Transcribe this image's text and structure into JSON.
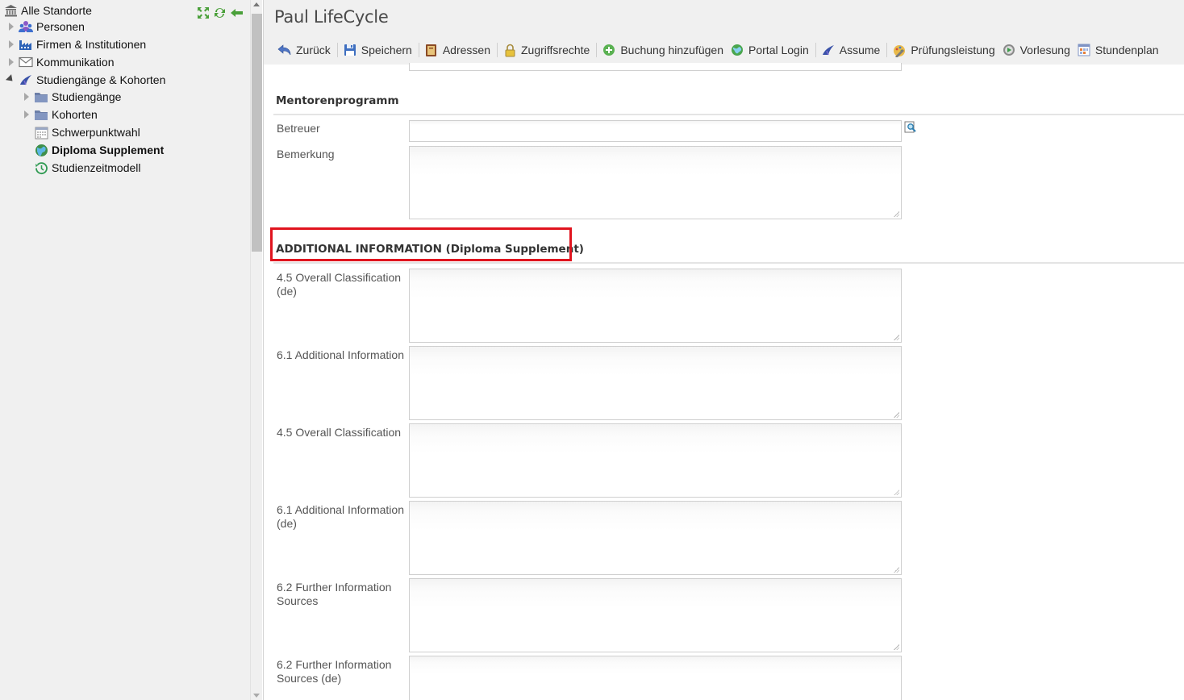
{
  "tree": {
    "root_label": "Alle Standorte",
    "items": [
      {
        "label": "Personen"
      },
      {
        "label": "Firmen & Institutionen"
      },
      {
        "label": "Kommunikation"
      },
      {
        "label": "Studiengänge & Kohorten"
      },
      {
        "label": "Studiengänge"
      },
      {
        "label": "Kohorten"
      },
      {
        "label": "Schwerpunktwahl"
      },
      {
        "label": "Diploma Supplement"
      },
      {
        "label": "Studienzeitmodell"
      }
    ],
    "selected": "Diploma Supplement"
  },
  "header": {
    "title": "Paul LifeCycle"
  },
  "toolbar": {
    "buttons": [
      {
        "label": "Zurück",
        "icon": "back-arrow-icon"
      },
      {
        "label": "Speichern",
        "icon": "save-disk-icon"
      },
      {
        "label": "Adressen",
        "icon": "address-book-icon"
      },
      {
        "label": "Zugriffsrechte",
        "icon": "lock-icon"
      },
      {
        "label": "Buchung hinzufügen",
        "icon": "add-circle-icon"
      },
      {
        "label": "Portal Login",
        "icon": "globe-icon"
      },
      {
        "label": "Assume",
        "icon": "graduation-cap-icon"
      },
      {
        "label": "Prüfungsleistung",
        "icon": "exam-pencil-icon"
      },
      {
        "label": "Vorlesung",
        "icon": "lecture-icon"
      },
      {
        "label": "Stundenplan",
        "icon": "calendar-grid-icon"
      }
    ]
  },
  "form": {
    "mentoring": {
      "title": "Mentorenprogramm",
      "betreuer_label": "Betreuer",
      "betreuer_value": "",
      "bemerkung_label": "Bemerkung",
      "bemerkung_value": ""
    },
    "additional": {
      "title": "ADDITIONAL INFORMATION (Diploma Supplement)",
      "fields": [
        {
          "label": "4.5 Overall Classification (de)",
          "value": ""
        },
        {
          "label": "6.1 Additional Information",
          "value": ""
        },
        {
          "label": "4.5 Overall Classification",
          "value": ""
        },
        {
          "label": "6.1 Additional Information (de)",
          "value": ""
        },
        {
          "label": "6.2 Further Information Sources",
          "value": ""
        },
        {
          "label": "6.2 Further Information Sources (de)",
          "value": ""
        }
      ]
    }
  },
  "colors": {
    "highlight": "#e0141e",
    "panel_bg": "#f0f0f0"
  }
}
